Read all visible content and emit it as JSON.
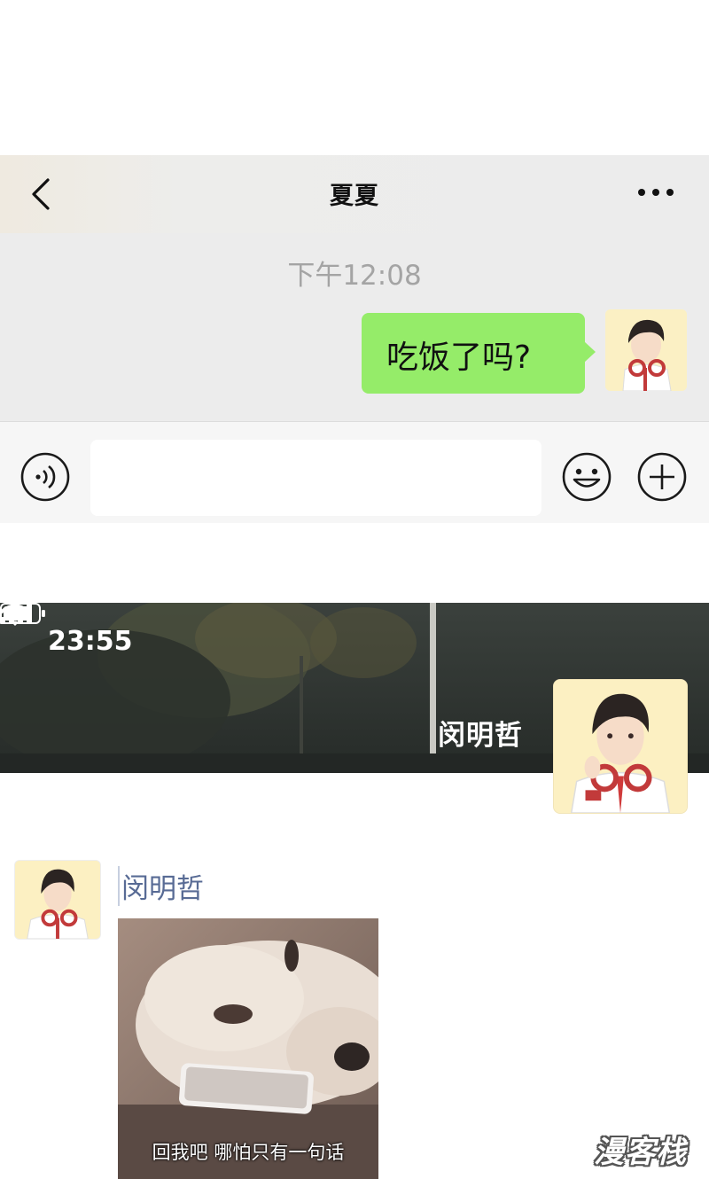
{
  "chat": {
    "title": "夏夏",
    "timestamp": "下午12:08",
    "message": "吃饭了吗?",
    "bubble_color": "#95ec69",
    "icons": {
      "back": "back-arrow-icon",
      "more": "more-dots-icon",
      "voice": "voice-input-icon",
      "emoji": "emoji-icon",
      "plus": "plus-icon"
    },
    "input_value": ""
  },
  "moments": {
    "status_time": "23:55",
    "cover_name": "闵明哲",
    "post_author": "闵明哲",
    "post_caption": "回我吧 哪怕只有一句话",
    "name_color": "#586b95",
    "icons": {
      "signal": "signal-icon",
      "wifi": "wifi-icon",
      "battery": "battery-icon"
    }
  },
  "watermark": "漫客栈"
}
